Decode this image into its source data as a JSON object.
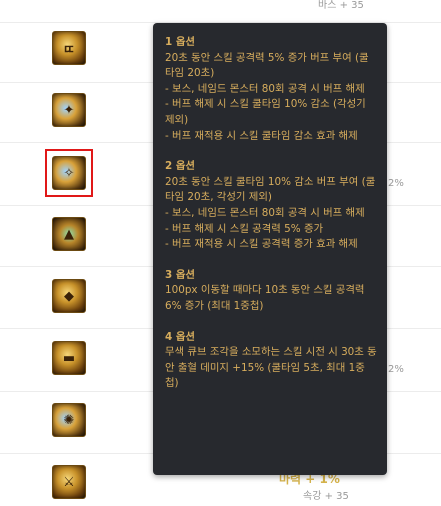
{
  "list": {
    "top_fragment": "바스 + 35",
    "side_pct_1": "2%",
    "side_pct_2": "2%",
    "bottom_gold": "마력 + 1%",
    "bottom_stat": "속강 + 35",
    "icons": [
      {
        "name": "item-icon-1",
        "glyph": "ㄸ"
      },
      {
        "name": "item-icon-2",
        "glyph": "✦"
      },
      {
        "name": "item-icon-3",
        "glyph": "✧"
      },
      {
        "name": "item-icon-4",
        "glyph": "▲"
      },
      {
        "name": "item-icon-5",
        "glyph": "◆"
      },
      {
        "name": "item-icon-6",
        "glyph": "▬"
      },
      {
        "name": "item-icon-7",
        "glyph": "✺"
      },
      {
        "name": "item-icon-8",
        "glyph": "⚔"
      }
    ]
  },
  "tooltip": {
    "options": [
      {
        "title": "1 옵션",
        "lines": [
          " 20초 동안 스킬 공격력 5% 증가 버프 부여 (쿨타임 20초)",
          "- 보스, 네임드 몬스터 80회 공격 시 버프 해제",
          "- 버프 해제 시 스킬 쿨타임 10% 감소 (각성기 제외)",
          "- 버프 재적용 시 스킬 쿨타임 감소 효과 해제"
        ]
      },
      {
        "title": "2 옵션",
        "lines": [
          " 20초 동안 스킬 쿨타임 10% 감소 버프 부여 (쿨타임 20초, 각성기 제외)",
          "- 보스, 네임드 몬스터 80회 공격 시 버프 해제",
          "- 버프 해제 시 스킬 공격력 5% 증가",
          "- 버프 재적용 시 스킬 공격력 증가 효과 해제"
        ]
      },
      {
        "title": "3 옵션",
        "lines": [
          " 100px 이동할 때마다 10초 동안 스킬 공격력 6% 증가 (최대 1중첩)"
        ]
      },
      {
        "title": "4 옵션",
        "lines": [
          " 무색 큐브 조각을 소모하는 스킬 시전 시 30초 동안 출혈 데미지 +15% (쿨타임 5초, 최대 1중첩)"
        ]
      }
    ]
  }
}
